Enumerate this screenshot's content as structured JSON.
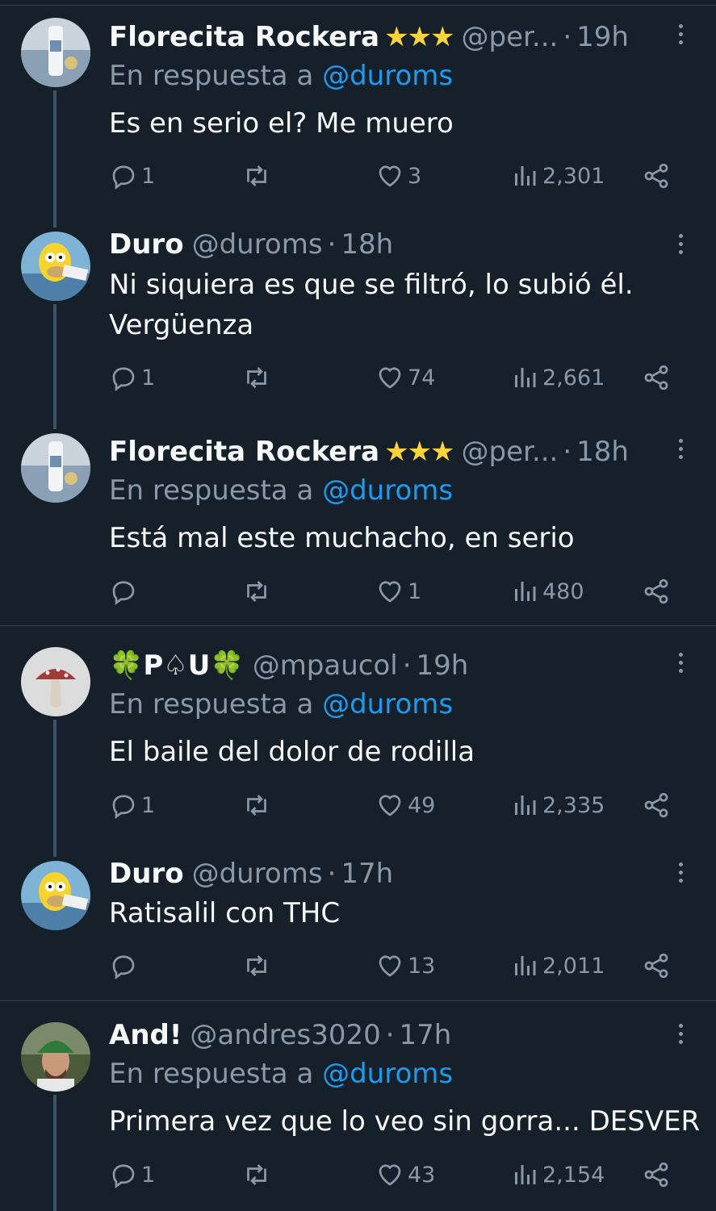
{
  "colors": {
    "background": "#15202b",
    "text": "#f7f9f9",
    "muted": "#8b98a5",
    "link": "#1d9bf0",
    "stars": "#ffd43b"
  },
  "reply_prefix": "En respuesta a",
  "tweets": [
    {
      "name": "Florecita Rockera",
      "badge": "★★★",
      "handle": "@per...",
      "time": "19h",
      "reply_to": "@duroms",
      "text": "Es en serio el? Me muero",
      "replies": "1",
      "retweets": "",
      "likes": "3",
      "views": "2,301",
      "avatar": "bottle-avatar"
    },
    {
      "name": "Duro",
      "badge": "",
      "handle": "@duroms",
      "time": "18h",
      "reply_to": "",
      "text": "Ni siquiera es que se filtró, lo subió él.\nVergüenza",
      "replies": "1",
      "retweets": "",
      "likes": "74",
      "views": "2,661",
      "avatar": "homer-avatar"
    },
    {
      "name": "Florecita Rockera",
      "badge": "★★★",
      "handle": "@per...",
      "time": "18h",
      "reply_to": "@duroms",
      "text": "Está mal este muchacho, en serio",
      "replies": "",
      "retweets": "",
      "likes": "1",
      "views": "480",
      "avatar": "bottle-avatar"
    },
    {
      "name": "🍀P♤U🍀",
      "badge": "",
      "handle": "@mpaucol",
      "time": "19h",
      "reply_to": "@duroms",
      "text": "El baile del dolor de rodilla",
      "replies": "1",
      "retweets": "",
      "likes": "49",
      "views": "2,335",
      "avatar": "mushroom-avatar"
    },
    {
      "name": "Duro",
      "badge": "",
      "handle": "@duroms",
      "time": "17h",
      "reply_to": "",
      "text": "Ratisalil con THC",
      "replies": "",
      "retweets": "",
      "likes": "13",
      "views": "2,011",
      "avatar": "homer-avatar"
    },
    {
      "name": "And!",
      "badge": "",
      "handle": "@andres3020",
      "time": "17h",
      "reply_to": "@duroms",
      "text": "Primera vez que lo veo sin gorra... DESVER",
      "replies": "1",
      "retweets": "",
      "likes": "43",
      "views": "2,154",
      "avatar": "man-cap-avatar"
    }
  ]
}
